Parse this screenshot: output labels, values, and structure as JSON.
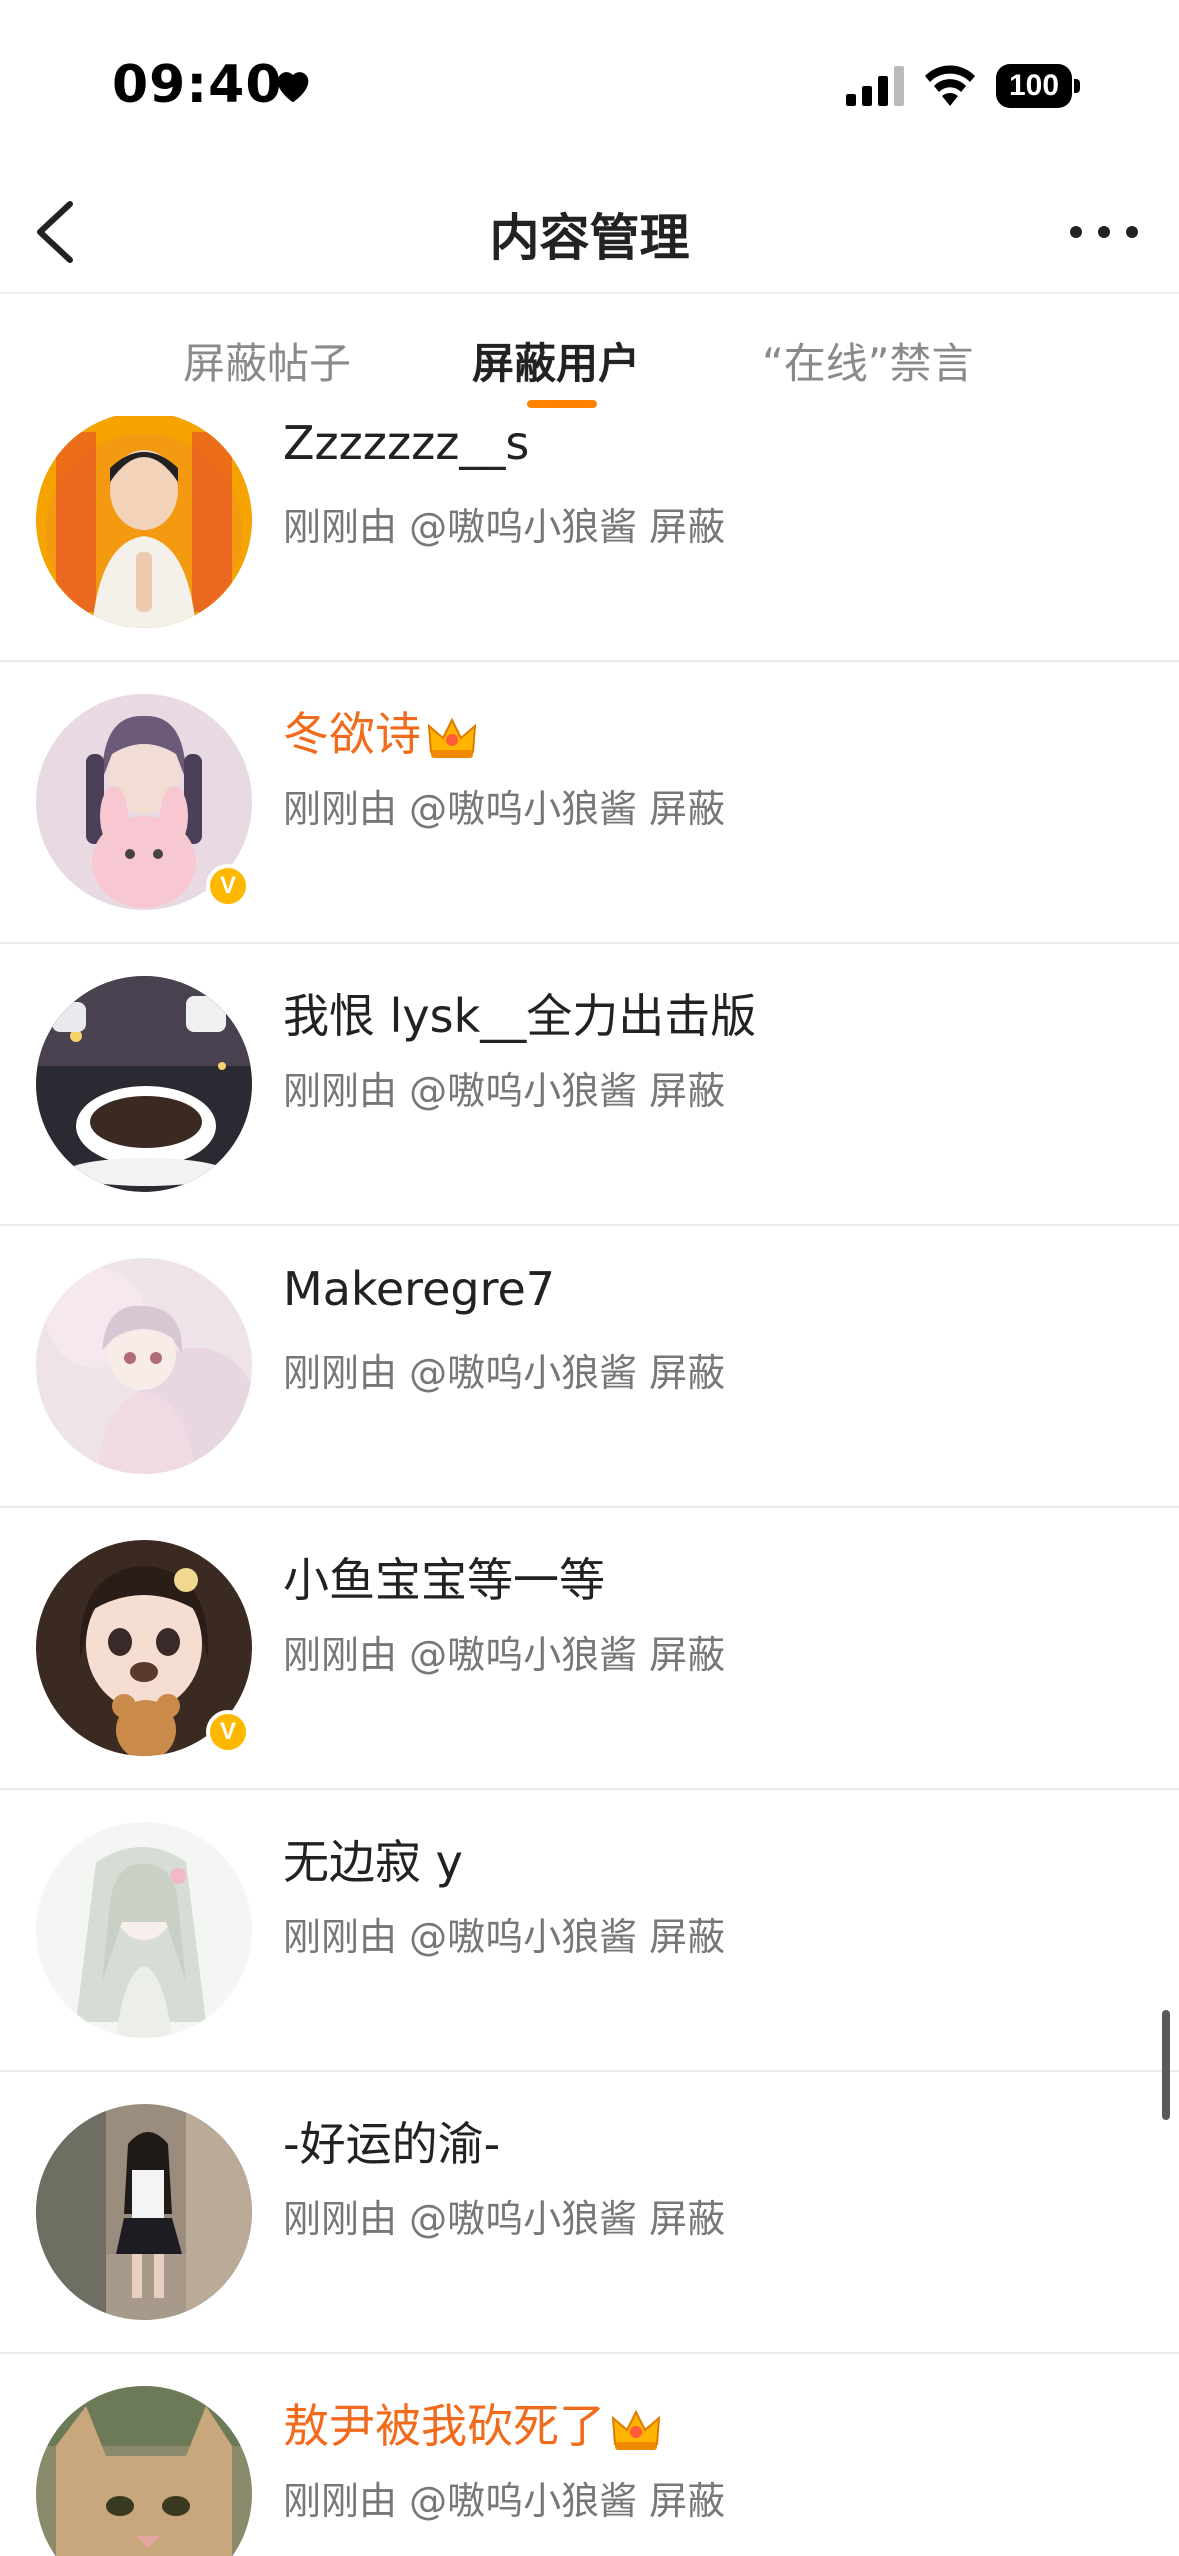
{
  "status_bar": {
    "time": "09:40",
    "battery": "100"
  },
  "nav": {
    "title": "内容管理"
  },
  "tabs": [
    {
      "label": "屏蔽帖子"
    },
    {
      "label": "屏蔽用户"
    },
    {
      "label": "“在线”禁言"
    }
  ],
  "accent_color": "#ff8200",
  "vip_name_color": "#f26b1d",
  "users": [
    {
      "name": "Zzzzzzz__s",
      "sub": "刚刚由 @嗷呜小狼酱 屏蔽",
      "verified": false,
      "vip": false
    },
    {
      "name": "冬欲诗",
      "sub": "刚刚由 @嗷呜小狼酱 屏蔽",
      "verified": true,
      "vip": true
    },
    {
      "name": "我恨 lysk__全力出击版",
      "sub": "刚刚由 @嗷呜小狼酱 屏蔽",
      "verified": false,
      "vip": false
    },
    {
      "name": "Makeregre7",
      "sub": "刚刚由 @嗷呜小狼酱 屏蔽",
      "verified": false,
      "vip": false
    },
    {
      "name": "小鱼宝宝等一等",
      "sub": "刚刚由 @嗷呜小狼酱 屏蔽",
      "verified": true,
      "vip": false
    },
    {
      "name": "无边寂 y",
      "sub": "刚刚由 @嗷呜小狼酱 屏蔽",
      "verified": false,
      "vip": false
    },
    {
      "name": "-好运的渝-",
      "sub": "刚刚由 @嗷呜小狼酱 屏蔽",
      "verified": false,
      "vip": false
    },
    {
      "name": "敖尹被我砍死了",
      "sub": "刚刚由 @嗷呜小狼酱 屏蔽",
      "verified": false,
      "vip": true
    }
  ],
  "icons": {
    "heart": "heart-icon",
    "signal": "cellular-signal-icon",
    "wifi": "wifi-icon",
    "back": "chevron-left-icon",
    "more": "more-dots-icon",
    "crown": "vip-crown-icon",
    "verified": "verified-badge-icon"
  },
  "verified_badge": "V"
}
